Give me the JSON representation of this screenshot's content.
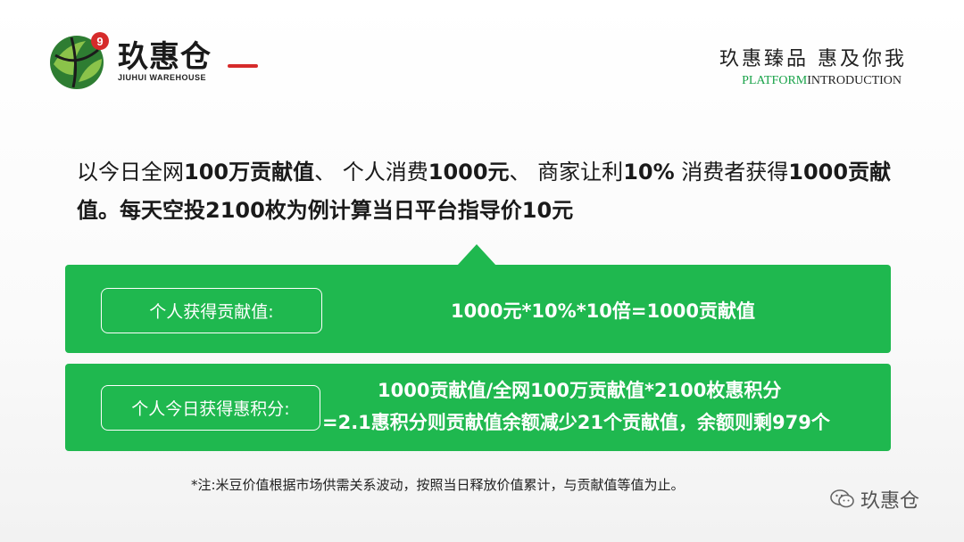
{
  "brand": {
    "name_cn": "玖惠仓",
    "name_en": "JIUHUI WAREHOUSE",
    "badge": "9",
    "colors": {
      "green": "#1fb84f",
      "dark_green": "#2e7d32",
      "red": "#d62b2b"
    }
  },
  "header": {
    "slogan": "玖惠臻品 惠及你我",
    "intro_green": "PLATFORM",
    "intro_dark": "INTRODUCTION"
  },
  "headline": {
    "p1": "以今日全网",
    "b1": "100万贡献值",
    "p2": "、 个人消费",
    "b2": "1000元",
    "p3": "、 商家让利",
    "b3": "10%",
    "p4": " 消费者获得",
    "b4": "1000贡献值。每天空投2100枚为例计算当日平台指导价10元"
  },
  "panels": [
    {
      "label": "个人获得贡献值:",
      "formula": [
        "1000元*10%*10倍=1000贡献值"
      ]
    },
    {
      "label": "个人今日获得惠积分:",
      "formula": [
        "1000贡献值/全网100万贡献值*2100枚惠积分",
        "=2.1惠积分则贡献值余额减少21个贡献值，余额则剩979个"
      ]
    }
  ],
  "note": "*注:米豆价值根据市场供需关系波动，按照当日释放价值累计，与贡献值等值为止。",
  "watermark": {
    "text": "玖惠仓",
    "icon": "wechat-icon"
  }
}
